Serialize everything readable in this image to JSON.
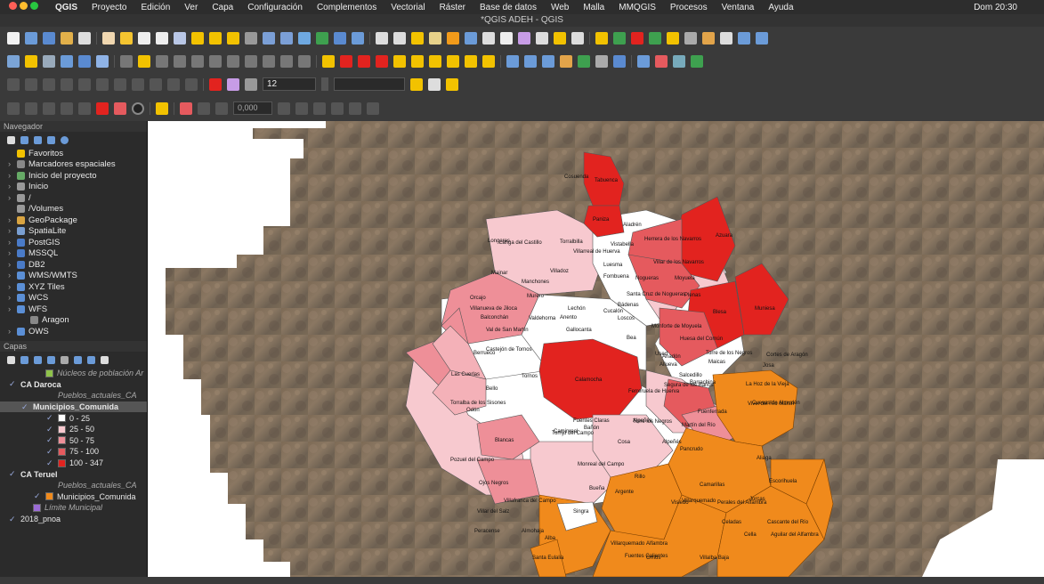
{
  "menubar": {
    "items": [
      "QGIS",
      "Proyecto",
      "Edición",
      "Ver",
      "Capa",
      "Configuración",
      "Complementos",
      "Vectorial",
      "Ráster",
      "Base de datos",
      "Web",
      "Malla",
      "MMQGIS",
      "Procesos",
      "Ventana",
      "Ayuda"
    ],
    "clock": "Dom 20:30"
  },
  "window": {
    "title": "*QGIS ADEH - QGIS"
  },
  "toolbar": {
    "font_size": "12",
    "coord_value": "0,000"
  },
  "navigator": {
    "title": "Navegador",
    "items": [
      {
        "label": "Favoritos",
        "icon": "star-icon",
        "color": "#f2c200"
      },
      {
        "label": "Marcadores espaciales",
        "icon": "bookmark-icon",
        "color": "#888"
      },
      {
        "label": "Inicio del proyecto",
        "icon": "project-home-icon",
        "color": "#6a6"
      },
      {
        "label": "Inicio",
        "icon": "home-folder-icon",
        "color": "#999"
      },
      {
        "label": "/",
        "icon": "folder-icon",
        "color": "#999"
      },
      {
        "label": "/Volumes",
        "icon": "folder-icon",
        "color": "#999"
      },
      {
        "label": "GeoPackage",
        "icon": "geopackage-icon",
        "color": "#d9a441"
      },
      {
        "label": "SpatiaLite",
        "icon": "spatialite-icon",
        "color": "#7a9fd1"
      },
      {
        "label": "PostGIS",
        "icon": "postgis-icon",
        "color": "#4a7bc8"
      },
      {
        "label": "MSSQL",
        "icon": "mssql-icon",
        "color": "#4a7bc8"
      },
      {
        "label": "DB2",
        "icon": "db2-icon",
        "color": "#4a7bc8"
      },
      {
        "label": "WMS/WMTS",
        "icon": "wms-icon",
        "color": "#5b8fd6"
      },
      {
        "label": "XYZ Tiles",
        "icon": "xyz-icon",
        "color": "#5b8fd6"
      },
      {
        "label": "WCS",
        "icon": "wcs-icon",
        "color": "#5b8fd6"
      },
      {
        "label": "WFS",
        "icon": "wfs-icon",
        "color": "#5b8fd6"
      },
      {
        "label": "Aragon",
        "icon": "wfs-connection-icon",
        "color": "#888"
      },
      {
        "label": "OWS",
        "icon": "ows-icon",
        "color": "#5b8fd6"
      }
    ]
  },
  "layers": {
    "title": "Capas",
    "items": [
      {
        "label": "Núcleos de población Ar",
        "swatch": "#8fc34a",
        "checked": false,
        "italic": true,
        "indent": 38
      },
      {
        "label": "CA Daroca",
        "swatch": "",
        "checked": true,
        "italic": false,
        "indent": 10,
        "group": true
      },
      {
        "label": "Pueblos_actuales_CA",
        "swatch": "",
        "checked": false,
        "italic": true,
        "indent": 52
      },
      {
        "label": "Municipios_Comunida",
        "swatch": "",
        "checked": true,
        "italic": false,
        "indent": 24,
        "selected": true
      },
      {
        "label": "0 - 25",
        "swatch": "#ffffff",
        "checked": true,
        "italic": false,
        "indent": 52
      },
      {
        "label": "25 - 50",
        "swatch": "#f7c9cf",
        "checked": true,
        "italic": false,
        "indent": 52
      },
      {
        "label": "50 - 75",
        "swatch": "#ee8f98",
        "checked": true,
        "italic": false,
        "indent": 52
      },
      {
        "label": "75 - 100",
        "swatch": "#e55a5e",
        "checked": true,
        "italic": false,
        "indent": 52
      },
      {
        "label": "100 - 347",
        "swatch": "#e2231f",
        "checked": true,
        "italic": false,
        "indent": 52
      },
      {
        "label": "CA Teruel",
        "swatch": "",
        "checked": true,
        "italic": false,
        "indent": 10,
        "group": true
      },
      {
        "label": "Pueblos_actuales_CA",
        "swatch": "",
        "checked": false,
        "italic": true,
        "indent": 52
      },
      {
        "label": "Municipios_Comunida",
        "swatch": "#f08a1c",
        "checked": true,
        "italic": false,
        "indent": 38
      },
      {
        "label": "Límite Municipal",
        "swatch": "#9b6cd6",
        "checked": false,
        "italic": true,
        "indent": 24
      },
      {
        "label": "2018_pnoa",
        "swatch": "",
        "checked": true,
        "italic": false,
        "indent": 10
      }
    ]
  },
  "map": {
    "labels": [
      {
        "t": "Cosuenda"
      },
      {
        "t": "Tabuenca"
      },
      {
        "t": "Paniza"
      },
      {
        "t": "Aladrén"
      },
      {
        "t": "Longares"
      },
      {
        "t": "Langa del Castillo"
      },
      {
        "t": "Torralbilla"
      },
      {
        "t": "Villarreal de Huerva"
      },
      {
        "t": "Vistabella"
      },
      {
        "t": "Herrera de los Navarros"
      },
      {
        "t": "Azuara"
      },
      {
        "t": "Villar de los Navarros"
      },
      {
        "t": "Mainar"
      },
      {
        "t": "Villadoz"
      },
      {
        "t": "Luesma"
      },
      {
        "t": "Fombuena"
      },
      {
        "t": "Nogueras"
      },
      {
        "t": "Moyuela"
      },
      {
        "t": "Manchones"
      },
      {
        "t": "Santa Cruz de Nogueras"
      },
      {
        "t": "Plenas"
      },
      {
        "t": "Orcajo"
      },
      {
        "t": "Murero"
      },
      {
        "t": "Lechón"
      },
      {
        "t": "Cucalón"
      },
      {
        "t": "Bádenas"
      },
      {
        "t": "Villanueva de Jiloca"
      },
      {
        "t": "Anento"
      },
      {
        "t": "Loscos"
      },
      {
        "t": "Blesa"
      },
      {
        "t": "Muniesa"
      },
      {
        "t": "Balconchán"
      },
      {
        "t": "Valdehorna"
      },
      {
        "t": "Monforte de Moyuela"
      },
      {
        "t": "Val de San Martín"
      },
      {
        "t": "Gallocanta"
      },
      {
        "t": "Huesa del Común"
      },
      {
        "t": "Used"
      },
      {
        "t": "Berrueco"
      },
      {
        "t": "Bea"
      },
      {
        "t": "Torre de los Negros"
      },
      {
        "t": "Cortes de Aragón"
      },
      {
        "t": "Castejón de Tornos"
      },
      {
        "t": "Anadón"
      },
      {
        "t": "Maicas"
      },
      {
        "t": "Las Cuerlas"
      },
      {
        "t": "Tornos"
      },
      {
        "t": "Calamocha"
      },
      {
        "t": "Allueva"
      },
      {
        "t": "Josa"
      },
      {
        "t": "Bello"
      },
      {
        "t": "Segura de los Baños"
      },
      {
        "t": "Salcedillo"
      },
      {
        "t": "Torralba de los Sisones"
      },
      {
        "t": "Ferreruela de Huerva"
      },
      {
        "t": "Barrachina"
      },
      {
        "t": "La Hoz de la Vieja"
      },
      {
        "t": "Odón"
      },
      {
        "t": "Cuevas de Almudén"
      },
      {
        "t": "Fuentes Claras"
      },
      {
        "t": "Alpeñés"
      },
      {
        "t": "Vivel del Río Martín"
      },
      {
        "t": "Caminreal"
      },
      {
        "t": "Torre los Negros"
      },
      {
        "t": "Fuenferrada"
      },
      {
        "t": "Torrijo del Campo"
      },
      {
        "t": "Bañón"
      },
      {
        "t": "Cosa"
      },
      {
        "t": "Alpeñés"
      },
      {
        "t": "Martín del Río"
      },
      {
        "t": "Blancas"
      },
      {
        "t": "Pozuel del Campo"
      },
      {
        "t": "Monreal del Campo"
      },
      {
        "t": "Pancrudo"
      },
      {
        "t": "Aliaga"
      },
      {
        "t": "Ojos Negros"
      },
      {
        "t": "Bueña"
      },
      {
        "t": "Argente"
      },
      {
        "t": "Rillo"
      },
      {
        "t": "Escorihuela"
      },
      {
        "t": "Camarillas"
      },
      {
        "t": "Villarquemado"
      },
      {
        "t": "Villafranca del Campo"
      },
      {
        "t": "Villar del Salz"
      },
      {
        "t": "Visiedo"
      },
      {
        "t": "Perales del Alfambra"
      },
      {
        "t": "Jorcas"
      },
      {
        "t": "Peracense"
      },
      {
        "t": "Singra"
      },
      {
        "t": "Almohaja"
      },
      {
        "t": "Celadas"
      },
      {
        "t": "Cascante del Río"
      },
      {
        "t": "Alba"
      },
      {
        "t": "Villarquemado"
      },
      {
        "t": "Alfambra"
      },
      {
        "t": "Santa Eulalia"
      },
      {
        "t": "Cella"
      },
      {
        "t": "Aguilar del Alfambra"
      },
      {
        "t": "Orrios"
      },
      {
        "t": "Villalba Baja"
      },
      {
        "t": "Fuentes Calientes"
      }
    ]
  },
  "colors": {
    "class_0_25": "#ffffff",
    "class_25_50": "#f7c9cf",
    "class_50_75": "#ee8f98",
    "class_75_100": "#e55a5e",
    "class_100_347": "#e2231f",
    "teruel": "#f08a1c"
  }
}
